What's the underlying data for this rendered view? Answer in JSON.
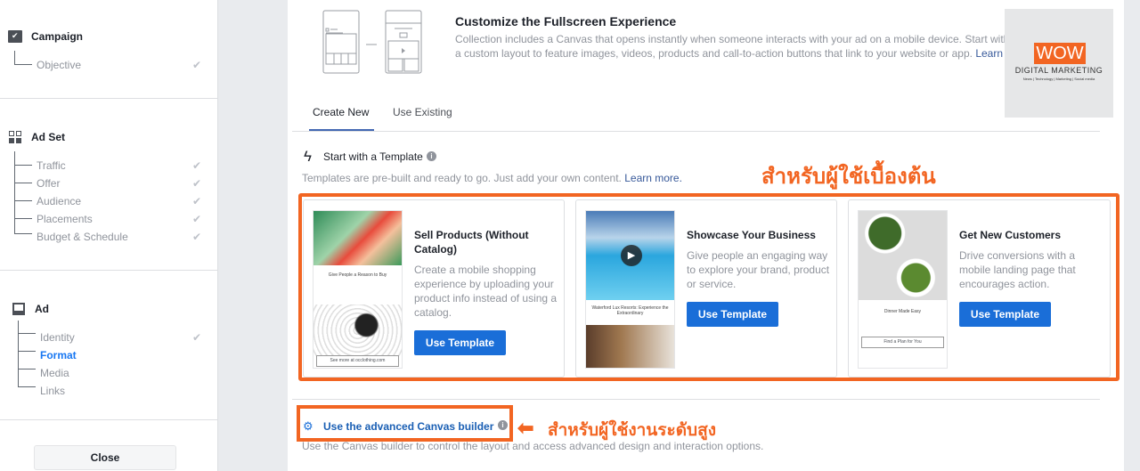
{
  "sidebar": {
    "campaign": {
      "title": "Campaign",
      "items": [
        {
          "label": "Objective",
          "done": true
        }
      ]
    },
    "adset": {
      "title": "Ad Set",
      "items": [
        {
          "label": "Traffic",
          "done": true
        },
        {
          "label": "Offer",
          "done": true
        },
        {
          "label": "Audience",
          "done": true
        },
        {
          "label": "Placements",
          "done": true
        },
        {
          "label": "Budget & Schedule",
          "done": true
        }
      ]
    },
    "ad": {
      "title": "Ad",
      "items": [
        {
          "label": "Identity",
          "done": true
        },
        {
          "label": "Format",
          "active": true
        },
        {
          "label": "Media"
        },
        {
          "label": "Links"
        }
      ]
    },
    "close_label": "Close",
    "check_glyph": "✔"
  },
  "header": {
    "title": "Customize the Fullscreen Experience",
    "desc_line1": "Collection includes a Canvas that opens instantly when someone interacts with your ad on a mobile device. Start with",
    "desc_line2": "a custom layout to feature images, videos, products and call-to-action buttons that link to your website or app.",
    "learn": "Learn"
  },
  "logo": {
    "brand": "WOW",
    "line1": "DIGITAL MARKETING",
    "line2": "News | Technology | Marketing | Social media"
  },
  "tabs": [
    {
      "label": "Create New",
      "active": true
    },
    {
      "label": "Use Existing"
    }
  ],
  "template_section": {
    "title": "Start with a Template",
    "desc": "Templates are pre-built and ready to go. Just add your own content.",
    "learn_more": "Learn more."
  },
  "annotations": {
    "beginner": "สำหรับผู้ใช้เบื้องต้น",
    "advanced": "สำหรับผู้ใช้งานระดับสูง",
    "color": "#f26522"
  },
  "cards": [
    {
      "title": "Sell Products (Without Catalog)",
      "desc": "Create a mobile shopping experience by uploading your product info instead of using a catalog.",
      "button": "Use Template",
      "thumb_title": "Give People a Reason to Buy",
      "thumb_cta": "See more at occlothing.com"
    },
    {
      "title": "Showcase Your Business",
      "desc": "Give people an engaging way to explore your brand, product or service.",
      "button": "Use Template",
      "thumb_title": "Waterford Lux Resorts: Experience the Extraordinary"
    },
    {
      "title": "Get New Customers",
      "desc": "Drive conversions with a mobile landing page that encourages action.",
      "button": "Use Template",
      "thumb_title": "Dinner Made Easy",
      "thumb_cta": "Find a Plan for You"
    }
  ],
  "advanced": {
    "label": "Use the advanced Canvas builder",
    "desc": "Use the Canvas builder to control the layout and access advanced design and interaction options."
  }
}
